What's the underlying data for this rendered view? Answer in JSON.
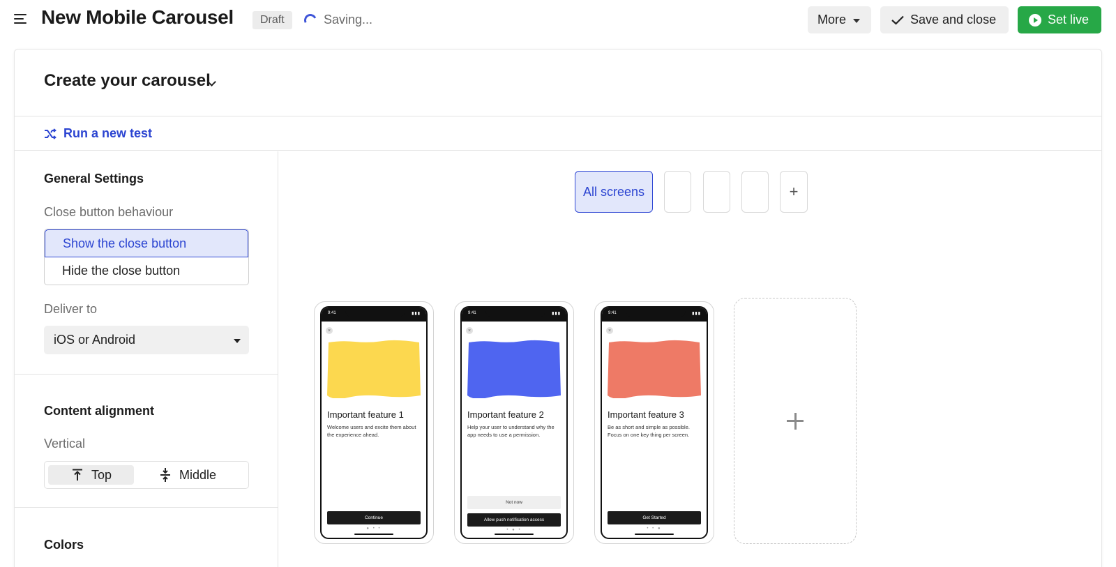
{
  "header": {
    "title": "New Mobile Carousel",
    "status_badge": "Draft",
    "saving_text": "Saving...",
    "more_label": "More",
    "save_close_label": "Save and close",
    "set_live_label": "Set live"
  },
  "card": {
    "title": "Create your carousel",
    "run_test_label": "Run a new test"
  },
  "settings": {
    "general_title": "General Settings",
    "close_behaviour_label": "Close button behaviour",
    "close_options": [
      "Show the close button",
      "Hide the close button"
    ],
    "close_selected": "Show the close button",
    "deliver_label": "Deliver to",
    "deliver_value": "iOS or Android",
    "alignment_title": "Content alignment",
    "vertical_label": "Vertical",
    "vertical_options": [
      "Top",
      "Middle"
    ],
    "vertical_selected": "Top",
    "colors_title": "Colors"
  },
  "screen_tabs": {
    "all_label": "All screens",
    "add_symbol": "+"
  },
  "screens": [
    {
      "time": "9:41",
      "image_color": "#fcd84f",
      "heading": "Important feature 1",
      "body": "Welcome users and excite them about the experience ahead.",
      "secondary": "",
      "cta": "Continue",
      "dots": "● • •"
    },
    {
      "time": "9:41",
      "image_color": "#4f65f0",
      "heading": "Important feature 2",
      "body": "Help your user to understand why the app needs to use a permission.",
      "secondary": "Not now",
      "cta": "Allow push notification access",
      "dots": "• ● •"
    },
    {
      "time": "9:41",
      "image_color": "#ee7a66",
      "heading": "Important feature 3",
      "body": "Be as short and simple as possible. Focus on one key thing per screen.",
      "secondary": "",
      "cta": "Get Started",
      "dots": "• • ●"
    }
  ],
  "colors": {
    "accent": "#2b44d1",
    "go_live": "#27a847"
  }
}
